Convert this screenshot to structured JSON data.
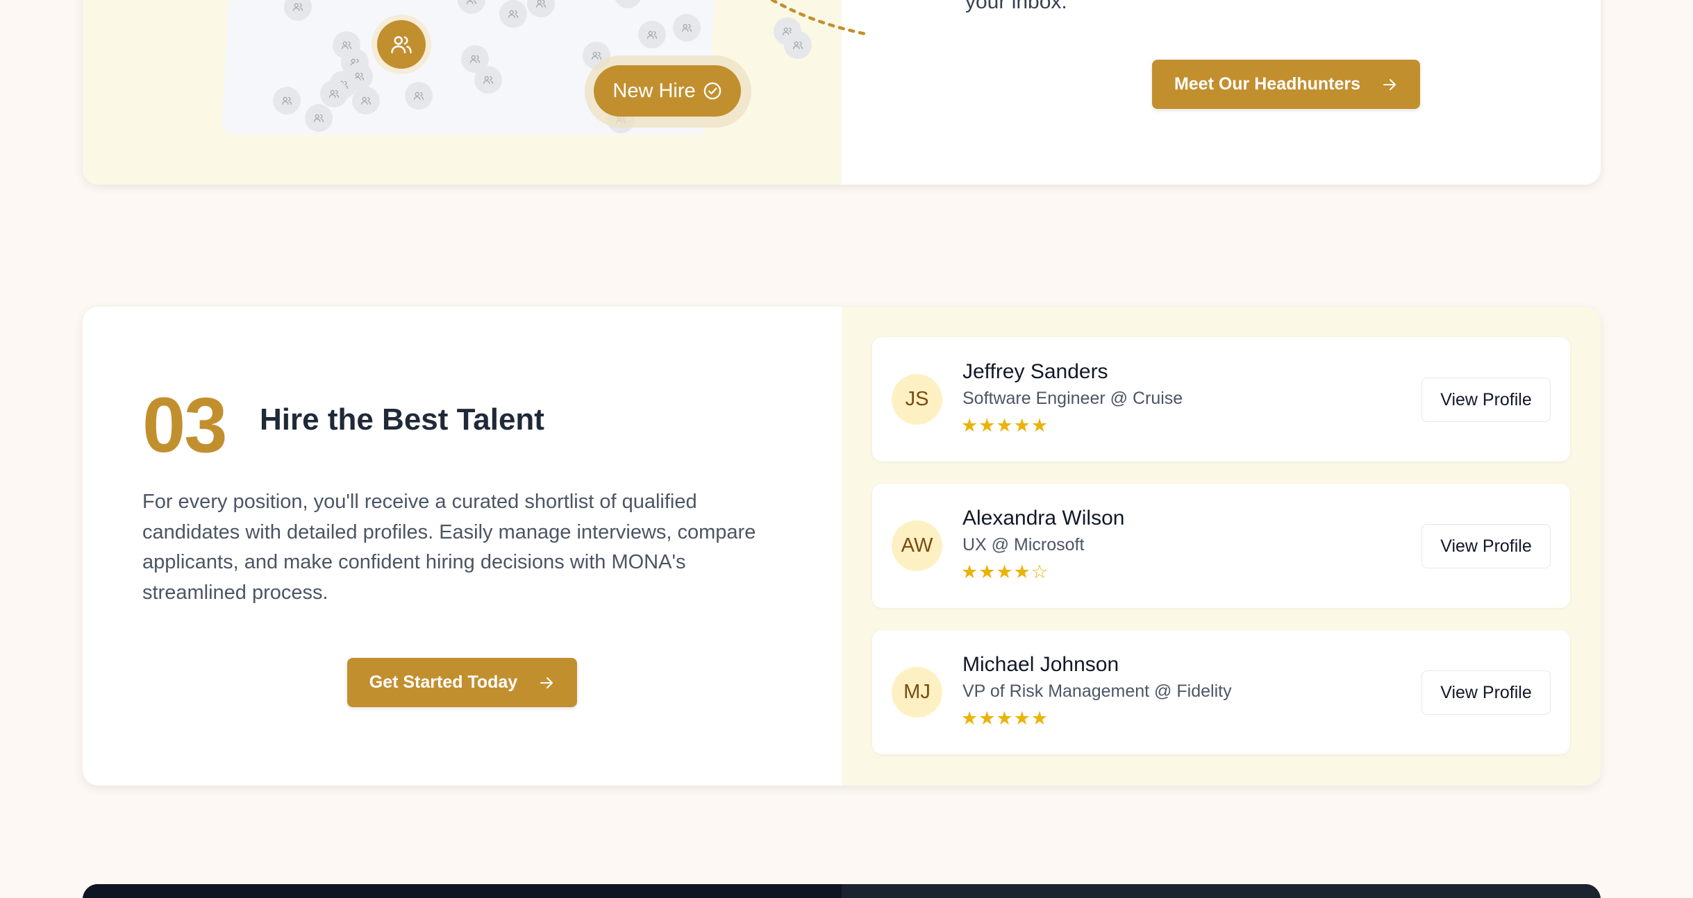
{
  "section_two": {
    "intro_text_fragment": "your inbox.",
    "new_hire_label": "New Hire",
    "cta_label": "Meet Our Headhunters"
  },
  "section_three": {
    "step_number": "03",
    "title": "Hire the Best Talent",
    "description": "For every position, you'll receive a curated shortlist of qualified candidates with detailed profiles. Easily manage interviews, compare applicants, and make confident hiring decisions with MONA's streamlined process.",
    "cta_label": "Get Started Today",
    "candidates": [
      {
        "initials": "JS",
        "name": "Jeffrey Sanders",
        "role": "Software Engineer @ Cruise",
        "stars": "★★★★★",
        "rating": 5,
        "button": "View Profile"
      },
      {
        "initials": "AW",
        "name": "Alexandra Wilson",
        "role": "UX @ Microsoft",
        "stars": "★★★★☆",
        "rating": 4,
        "button": "View Profile"
      },
      {
        "initials": "MJ",
        "name": "Michael Johnson",
        "role": "VP of Risk Management @ Fidelity",
        "stars": "★★★★★",
        "rating": 5,
        "button": "View Profile"
      }
    ]
  },
  "colors": {
    "accent": "#c28f2f",
    "page_background": "#fdf8f3",
    "panel_tint": "#fbf8e6",
    "star": "#eab308",
    "initials_bg": "#fdf1c4",
    "dark_section": "#111827"
  },
  "icons": {
    "hub": "users-icon",
    "network_avatar": "user-pair-icon",
    "new_hire": "check-circle-icon",
    "cta": "arrow-right-icon"
  }
}
